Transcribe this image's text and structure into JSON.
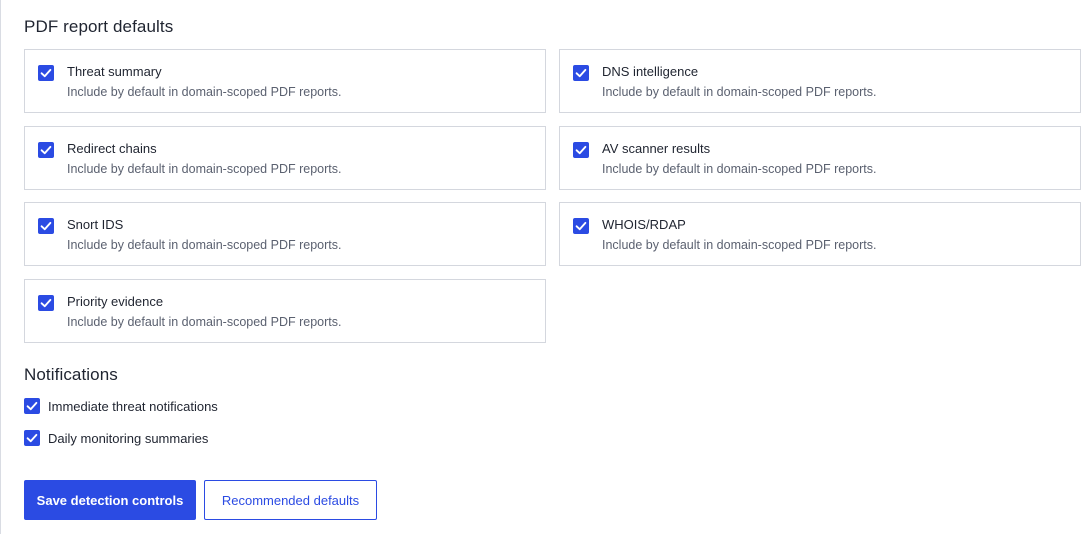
{
  "pdf_section": {
    "title": "PDF report defaults",
    "cards": [
      {
        "label": "Threat summary",
        "description": "Include by default in domain-scoped PDF reports.",
        "checked": true
      },
      {
        "label": "DNS intelligence",
        "description": "Include by default in domain-scoped PDF reports.",
        "checked": true
      },
      {
        "label": "Redirect chains",
        "description": "Include by default in domain-scoped PDF reports.",
        "checked": true
      },
      {
        "label": "AV scanner results",
        "description": "Include by default in domain-scoped PDF reports.",
        "checked": true
      },
      {
        "label": "Snort IDS",
        "description": "Include by default in domain-scoped PDF reports.",
        "checked": true
      },
      {
        "label": "WHOIS/RDAP",
        "description": "Include by default in domain-scoped PDF reports.",
        "checked": true
      },
      {
        "label": "Priority evidence",
        "description": "Include by default in domain-scoped PDF reports.",
        "checked": true
      }
    ]
  },
  "notifications": {
    "title": "Notifications",
    "items": [
      {
        "label": "Immediate threat notifications",
        "checked": true
      },
      {
        "label": "Daily monitoring summaries",
        "checked": true
      }
    ]
  },
  "actions": {
    "save_label": "Save detection controls",
    "recommended_label": "Recommended defaults"
  },
  "colors": {
    "accent": "#2b4be3",
    "border": "#d4d7de",
    "muted_text": "#5b6170"
  },
  "icons": {
    "checkbox_checked": "checkmark-icon"
  }
}
